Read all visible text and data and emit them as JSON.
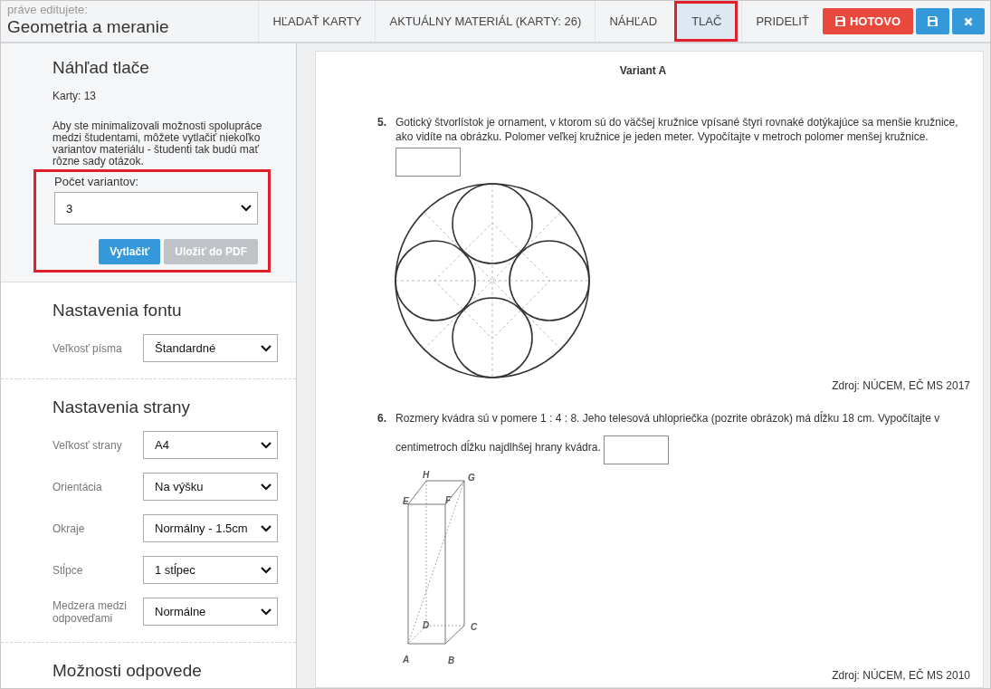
{
  "header": {
    "caption": "práve editujete:",
    "title": "Geometria a meranie"
  },
  "tabs": [
    {
      "label": "HĽADAŤ KARTY",
      "selected": false
    },
    {
      "label": "AKTUÁLNY MATERIÁL (KARTY: 26)",
      "selected": false
    },
    {
      "label": "NÁHĽAD",
      "selected": false
    },
    {
      "label": "TLAČ",
      "selected": true
    },
    {
      "label": "PRIDELIŤ",
      "selected": false
    }
  ],
  "actions": [
    {
      "kind": "done",
      "label": "HOTOVO"
    },
    {
      "kind": "save"
    },
    {
      "kind": "close"
    }
  ],
  "print_panel": {
    "title": "Náhľad tlače",
    "cards": "Karty: 13",
    "description": "Aby ste minimalizovali možnosti spolupráce medzi študentami, môžete vytlačiť niekoľko variantov materiálu - študenti tak budú mať rôzne sady otázok.",
    "highlighted": true,
    "variants_label": "Počet variantov:",
    "variants_value": "3",
    "print_button": "Vytlačiť",
    "pdf_button": {
      "label": "Uložiť do PDF",
      "disabled": true
    }
  },
  "sections": [
    {
      "title": "Nastavenia fontu",
      "fields": [
        {
          "label": "Veľkosť písma",
          "value": "Štandardné"
        }
      ]
    },
    {
      "title": "Nastavenia strany",
      "fields": [
        {
          "label": "Veľkosť strany",
          "value": "A4"
        },
        {
          "label": "Orientácia",
          "value": "Na výšku"
        },
        {
          "label": "Okraje",
          "value": "Normálny - 1.5cm"
        },
        {
          "label": "Stĺpce",
          "value": "1 stĺpec"
        },
        {
          "label": "Medzera medzi odpoveďami",
          "value": "Normálne"
        }
      ]
    },
    {
      "title": "Možnosti odpovede"
    }
  ],
  "preview": {
    "variant": "Variant A",
    "questions": [
      {
        "kind": "circles",
        "number": "5.",
        "text": "Gotický štvorlístok je ornament, v ktorom sú do väčšej kružnice vpísané štyri rovnaké dotýkajúce sa menšie kružnice, ako vidíte na obrázku. Polomer veľkej kružnice je jeden meter. Vypočítajte v metroch polomer menšej kružnice.",
        "source": "Zdroj: NÚCEM, EČ MS 2017"
      },
      {
        "kind": "cuboid",
        "number": "6.",
        "text": "Rozmery kvádra sú v pomere 1 : 4 : 8. Jeho telesová uhlopriečka (pozrite obrázok) má dĺžku 18 cm. Vypočítajte v centimetroch dĺžku najdlhšej hrany kvádra.",
        "vertex_labels": [
          "H",
          "G",
          "E",
          "F",
          "D",
          "C",
          "A",
          "B"
        ],
        "source": "Zdroj: NÚCEM, EČ MS 2010"
      }
    ]
  }
}
